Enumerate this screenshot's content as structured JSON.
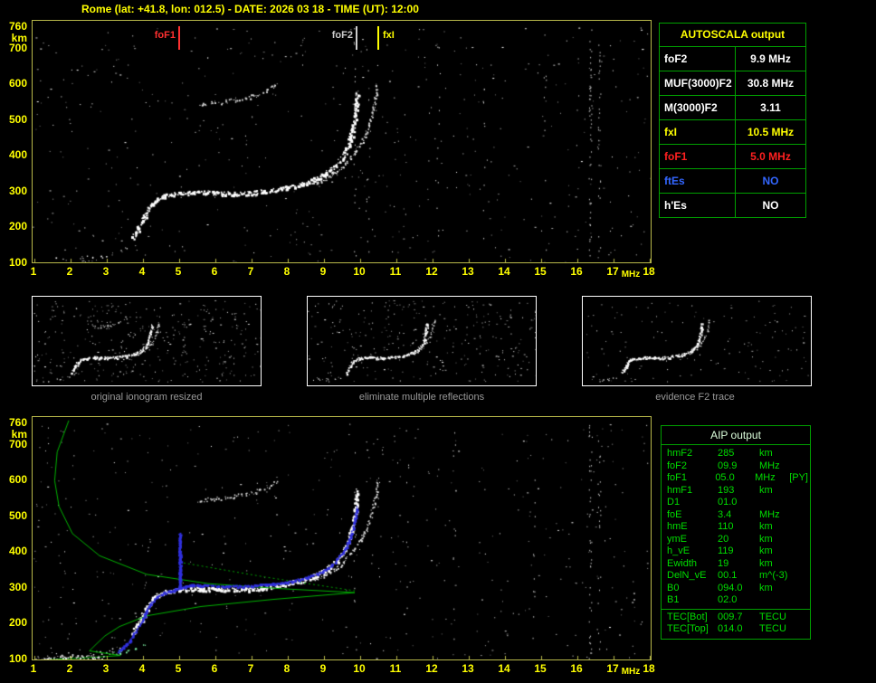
{
  "title": "Rome (lat: +41.8, lon: 012.5) - DATE: 2026 03 18 - TIME (UT): 12:00",
  "autoscala_table": {
    "title": "AUTOSCALA output",
    "rows": [
      {
        "label": "foF2",
        "value": "9.9 MHz",
        "color": "#ffffff"
      },
      {
        "label": "MUF(3000)F2",
        "value": "30.8 MHz",
        "color": "#ffffff"
      },
      {
        "label": "M(3000)F2",
        "value": "3.11",
        "color": "#ffffff"
      },
      {
        "label": "fxI",
        "value": "10.5 MHz",
        "color": "#ffff00"
      },
      {
        "label": "foF1",
        "value": "5.0 MHz",
        "color": "#ff2020"
      },
      {
        "label": "ftEs",
        "value": "NO",
        "color": "#3366ff"
      },
      {
        "label": "h'Es",
        "value": "NO",
        "color": "#ffffff"
      }
    ]
  },
  "aip_table": {
    "title": "AIP output",
    "rows": [
      {
        "label": "hmF2",
        "value": "285",
        "unit": "km"
      },
      {
        "label": "foF2",
        "value": "09.9",
        "unit": "MHz"
      },
      {
        "label": "foF1",
        "value": "05.0",
        "unit": "MHz",
        "note": "[PY]"
      },
      {
        "label": "hmF1",
        "value": "193",
        "unit": "km"
      },
      {
        "label": "D1",
        "value": "01.0",
        "unit": ""
      },
      {
        "label": "foE",
        "value": "3.4",
        "unit": "MHz"
      },
      {
        "label": "hmE",
        "value": "110",
        "unit": "km"
      },
      {
        "label": "ymE",
        "value": "20",
        "unit": "km"
      },
      {
        "label": "h_vE",
        "value": "119",
        "unit": "km"
      },
      {
        "label": "Ewidth",
        "value": "19",
        "unit": "km"
      },
      {
        "label": "DelN_vE",
        "value": "00.1",
        "unit": "m^(-3)"
      },
      {
        "label": "B0",
        "value": "094.0",
        "unit": "km"
      },
      {
        "label": "B1",
        "value": "02.0",
        "unit": ""
      }
    ],
    "tec_rows": [
      {
        "label": "TEC[Bot]",
        "value": "009.7",
        "unit": "TECU"
      },
      {
        "label": "TEC[Top]",
        "value": "014.0",
        "unit": "TECU"
      }
    ]
  },
  "thumbnails": [
    {
      "caption": "original ionogram resized"
    },
    {
      "caption": "eliminate multiple reflections"
    },
    {
      "caption": "evidence F2 trace"
    }
  ],
  "axes": {
    "x_ticks": [
      "1",
      "2",
      "3",
      "4",
      "5",
      "6",
      "7",
      "8",
      "9",
      "10",
      "11",
      "12",
      "13",
      "14",
      "15",
      "16",
      "17",
      "18"
    ],
    "x_unit": "MHz",
    "y_ticks": [
      "760",
      "700",
      "600",
      "500",
      "400",
      "300",
      "200",
      "100"
    ],
    "y_unit": "km"
  },
  "markers": [
    {
      "id": "fof1",
      "label": "foF1",
      "freq": 5.0,
      "color": "#ff3030",
      "label_side": "left"
    },
    {
      "id": "fof2",
      "label": "foF2",
      "freq": 9.9,
      "color": "#cccccc",
      "label_side": "left"
    },
    {
      "id": "fxi",
      "label": "fxI",
      "freq": 10.5,
      "color": "#ffff00",
      "label_side": "right"
    }
  ],
  "chart_data": {
    "type": "scatter",
    "title": "Ionogram with Autoscala scaling, Rome 2026-03-18 12:00 UT",
    "x_range": [
      1,
      18
    ],
    "x_unit": "MHz",
    "y_range": [
      100,
      760
    ],
    "y_unit": "km",
    "scaled_values": {
      "foF2_MHz": 9.9,
      "fxI_MHz": 10.5,
      "foF1_MHz": 5.0,
      "MUF3000F2_MHz": 30.8,
      "M3000F2": 3.11,
      "hmF2_km": 285,
      "hmF1_km": 193,
      "foE_MHz": 3.4,
      "hmE_km": 110
    },
    "white_traces": [
      {
        "id": "E",
        "name": "E-region echo trace",
        "color": "#e6e6e6",
        "mode": "dots",
        "size": 1.2,
        "jitter": 3,
        "step": 2,
        "density": 0.55,
        "points": [
          [
            1.5,
            118
          ],
          [
            2.1,
            112
          ],
          [
            2.7,
            116
          ],
          [
            3.2,
            126
          ],
          [
            3.5,
            142
          ]
        ]
      },
      {
        "id": "F",
        "name": "F-region O-mode trace",
        "color": "#ffffff",
        "mode": "dots",
        "size": 2,
        "jitter": 2.2,
        "step": 0.9,
        "density": 0.95,
        "points": [
          [
            3.7,
            172
          ],
          [
            3.85,
            196
          ],
          [
            4.0,
            226
          ],
          [
            4.15,
            256
          ],
          [
            4.35,
            278
          ],
          [
            4.6,
            290
          ],
          [
            5.0,
            296
          ],
          [
            5.5,
            299
          ],
          [
            6.0,
            297
          ],
          [
            6.5,
            296
          ],
          [
            7.0,
            298
          ],
          [
            7.5,
            304
          ],
          [
            8.0,
            313
          ],
          [
            8.5,
            326
          ],
          [
            8.9,
            343
          ],
          [
            9.2,
            363
          ],
          [
            9.5,
            396
          ],
          [
            9.7,
            442
          ],
          [
            9.82,
            492
          ],
          [
            9.88,
            542
          ],
          [
            9.9,
            576
          ]
        ]
      },
      {
        "id": "X",
        "name": "F-region X-mode trace",
        "color": "#dddddd",
        "mode": "dots",
        "size": 1.4,
        "jitter": 1.6,
        "step": 1.1,
        "density": 0.8,
        "points": [
          [
            8.7,
            322
          ],
          [
            9.1,
            340
          ],
          [
            9.5,
            368
          ],
          [
            9.85,
            412
          ],
          [
            10.15,
            462
          ],
          [
            10.32,
            512
          ],
          [
            10.42,
            562
          ],
          [
            10.47,
            604
          ]
        ]
      },
      {
        "id": "M2",
        "name": "second-hop multiple",
        "color": "#d8d8d8",
        "mode": "dots",
        "size": 1.4,
        "jitter": 2.2,
        "step": 1.4,
        "density": 0.7,
        "points": [
          [
            5.5,
            546
          ],
          [
            6.0,
            550
          ],
          [
            6.5,
            557
          ],
          [
            7.0,
            567
          ],
          [
            7.4,
            581
          ],
          [
            7.7,
            599
          ]
        ]
      }
    ],
    "bottom_extra_traces": [
      {
        "id": "profile",
        "name": "electron density profile",
        "color": "#00b400",
        "mode": "line",
        "width": 1,
        "points": [
          [
            1.95,
            768
          ],
          [
            1.63,
            680
          ],
          [
            1.56,
            600
          ],
          [
            1.68,
            528
          ],
          [
            2.05,
            452
          ],
          [
            2.8,
            390
          ],
          [
            4.1,
            338
          ],
          [
            5.8,
            312
          ],
          [
            7.8,
            298
          ],
          [
            9.85,
            287
          ],
          [
            7.6,
            268
          ],
          [
            5.6,
            248
          ],
          [
            4.1,
            222
          ],
          [
            3.35,
            192
          ],
          [
            2.95,
            166
          ],
          [
            2.7,
            142
          ],
          [
            2.52,
            124
          ],
          [
            3.38,
            111
          ],
          [
            2.3,
            104
          ],
          [
            1.5,
            100
          ],
          [
            1.1,
            98
          ]
        ]
      },
      {
        "id": "profile-dotted",
        "name": "profile extrapolation",
        "color": "#00a000",
        "mode": "dotted",
        "width": 1,
        "points": [
          [
            5.0,
            372
          ],
          [
            7.4,
            330
          ],
          [
            9.85,
            292
          ]
        ]
      },
      {
        "id": "fit",
        "name": "Autoscala fitted trace",
        "color": "#3030dd",
        "mode": "dots",
        "size": 2,
        "jitter": 1,
        "step": 1,
        "density": 0.95,
        "points": [
          [
            3.3,
            122
          ],
          [
            3.6,
            152
          ],
          [
            3.9,
            198
          ],
          [
            4.1,
            242
          ],
          [
            4.35,
            274
          ],
          [
            4.6,
            289
          ],
          [
            4.85,
            296
          ],
          [
            5.0,
            302
          ],
          [
            5.0,
            452
          ],
          [
            5.02,
            302
          ],
          [
            5.3,
            309
          ],
          [
            5.7,
            308
          ],
          [
            6.2,
            306
          ],
          [
            6.8,
            306
          ],
          [
            7.4,
            311
          ],
          [
            8.0,
            318
          ],
          [
            8.5,
            330
          ],
          [
            9.0,
            349
          ],
          [
            9.3,
            374
          ],
          [
            9.6,
            414
          ],
          [
            9.8,
            468
          ],
          [
            9.9,
            528
          ]
        ]
      },
      {
        "id": "E-mix",
        "name": "E-region colored echoes",
        "color": "#86ffae",
        "mode": "dots",
        "size": 1.4,
        "jitter": 3,
        "step": 1.6,
        "density": 0.5,
        "points": [
          [
            2.9,
            112
          ],
          [
            3.4,
            122
          ],
          [
            3.8,
            132
          ],
          [
            4.05,
            144
          ]
        ]
      },
      {
        "id": "E-base",
        "name": "low-altitude echoes",
        "color": "#f0f0f0",
        "mode": "dots",
        "size": 1.3,
        "jitter": 2.5,
        "step": 1,
        "density": 0.8,
        "points": [
          [
            1.05,
            103
          ],
          [
            1.6,
            105
          ],
          [
            2.2,
            107
          ],
          [
            2.9,
            108
          ]
        ]
      }
    ],
    "top_noise": {
      "count": 520,
      "stripes": [
        {
          "f": 16.35,
          "count": 50
        },
        {
          "f": 16.6,
          "count": 28
        },
        {
          "f": 15.1,
          "count": 10
        },
        {
          "f": 12.15,
          "count": 12
        },
        {
          "f": 9.85,
          "count": 16
        },
        {
          "f": 10.2,
          "count": 12
        },
        {
          "f": 13.4,
          "count": 8
        }
      ]
    },
    "bottom_noise": {
      "count": 480,
      "stripes": [
        {
          "f": 16.35,
          "count": 40
        },
        {
          "f": 16.6,
          "count": 22
        },
        {
          "f": 14.8,
          "count": 12
        },
        {
          "f": 12.6,
          "count": 10
        },
        {
          "f": 9.85,
          "count": 14
        },
        {
          "f": 11.3,
          "count": 8
        }
      ]
    },
    "thumbs": [
      {
        "include": [
          "E",
          "F",
          "X",
          "M2"
        ],
        "noise": 380
      },
      {
        "include": [
          "E",
          "F",
          "X"
        ],
        "noise": 300
      },
      {
        "include": [
          "E",
          "F",
          "X"
        ],
        "noise": 140
      }
    ]
  }
}
